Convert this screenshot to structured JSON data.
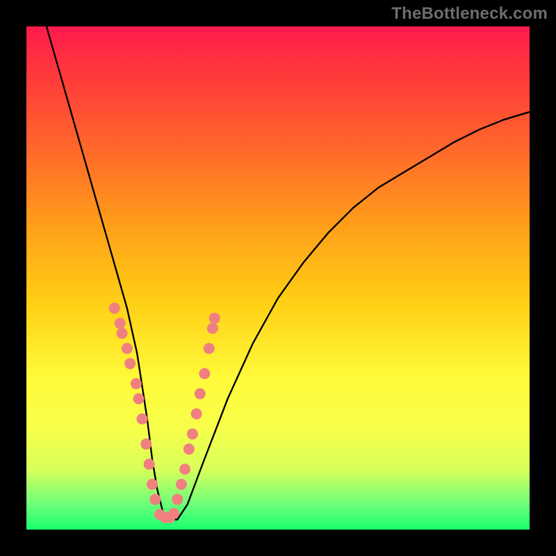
{
  "watermark": "TheBottleneck.com",
  "chart_data": {
    "type": "line",
    "title": "",
    "xlabel": "",
    "ylabel": "",
    "xlim": [
      0,
      100
    ],
    "ylim": [
      0,
      100
    ],
    "series": [
      {
        "name": "bottleneck-curve",
        "x": [
          4,
          6,
          8,
          10,
          12,
          14,
          16,
          18,
          20,
          22,
          24,
          25,
          26,
          27,
          28,
          30,
          32,
          35,
          40,
          45,
          50,
          55,
          60,
          65,
          70,
          75,
          80,
          85,
          90,
          95,
          100
        ],
        "values": [
          100,
          93,
          86,
          79,
          72,
          65,
          58,
          51,
          44,
          35,
          22,
          14,
          8,
          4,
          2,
          2,
          5,
          13,
          26,
          37,
          46,
          53,
          59,
          64,
          68,
          71,
          74,
          77,
          79.5,
          81.5,
          83
        ]
      }
    ],
    "markers_left": {
      "name": "dots-left-branch",
      "points": [
        [
          17.5,
          44
        ],
        [
          18.6,
          41
        ],
        [
          19.0,
          39
        ],
        [
          20.0,
          36
        ],
        [
          20.6,
          33
        ],
        [
          21.8,
          29
        ],
        [
          22.3,
          26
        ],
        [
          23.0,
          22
        ],
        [
          23.8,
          17
        ],
        [
          24.4,
          13
        ],
        [
          25.0,
          9
        ],
        [
          25.6,
          6
        ]
      ]
    },
    "markers_right": {
      "name": "dots-right-branch",
      "points": [
        [
          30.0,
          6
        ],
        [
          30.8,
          9
        ],
        [
          31.5,
          12
        ],
        [
          32.3,
          16
        ],
        [
          33.0,
          19
        ],
        [
          33.8,
          23
        ],
        [
          34.5,
          27
        ],
        [
          35.4,
          31
        ],
        [
          36.3,
          36
        ],
        [
          37.0,
          40
        ],
        [
          37.4,
          42
        ]
      ]
    },
    "markers_bottom": {
      "name": "dots-valley",
      "points": [
        [
          26.5,
          3.0
        ],
        [
          27.5,
          2.4
        ],
        [
          28.5,
          2.4
        ],
        [
          29.3,
          3.2
        ]
      ]
    },
    "colors": {
      "curve": "#000000",
      "dot_fill": "#F08080",
      "dot_stroke": "#F08080"
    }
  }
}
